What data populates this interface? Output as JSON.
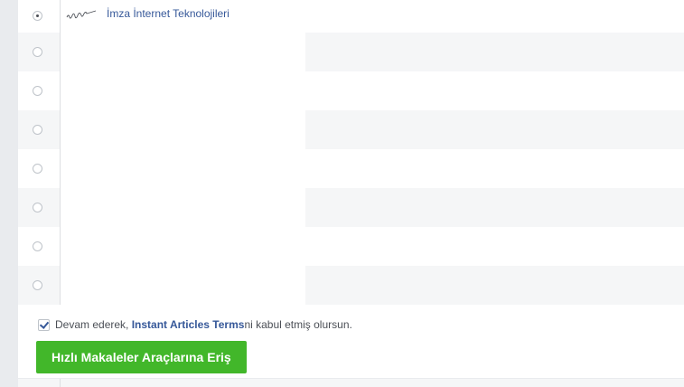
{
  "page_list": {
    "rows": [
      {
        "name": "İmza İnternet Teknolojileri",
        "selected": true,
        "logo": "imza-logo"
      },
      {
        "name": "",
        "selected": false
      },
      {
        "name": "",
        "selected": false
      },
      {
        "name": "",
        "selected": false
      },
      {
        "name": "",
        "selected": false
      },
      {
        "name": "",
        "selected": false
      },
      {
        "name": "",
        "selected": false
      },
      {
        "name": "",
        "selected": false
      }
    ]
  },
  "terms": {
    "checked": true,
    "prefix": "Devam ederek,",
    "link_text": "Instant Articles Terms",
    "suffix": "ni kabul etmiş olursun."
  },
  "cta": {
    "label": "Hızlı Makaleler Araçlarına Eriş"
  },
  "colors": {
    "link": "#365899",
    "button": "#42b72a",
    "alt_row": "#f5f6f7",
    "gutter": "#e9ebee"
  },
  "icons": {
    "radio": "radio-icon",
    "checkbox": "checkbox-checked-icon",
    "logo": "imza-logo-icon"
  }
}
